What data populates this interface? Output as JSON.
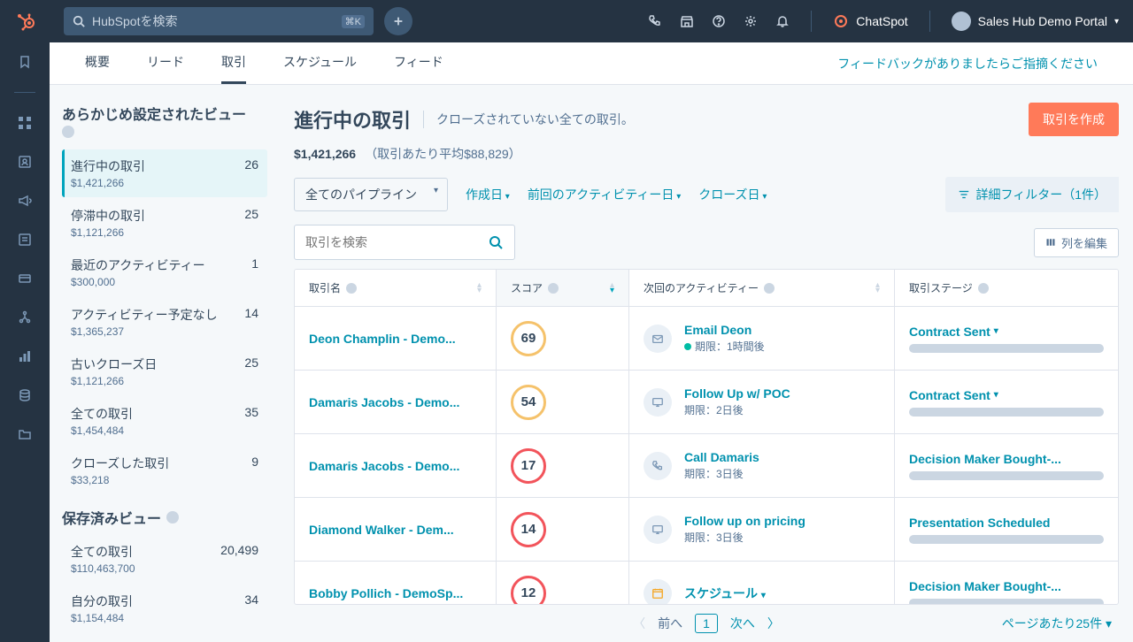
{
  "search_placeholder": "HubSpotを検索",
  "kbd": "⌘K",
  "chatspot": "ChatSpot",
  "portal": "Sales Hub Demo Portal",
  "tabs": [
    "概要",
    "リード",
    "取引",
    "スケジュール",
    "フィード"
  ],
  "active_tab": 2,
  "feedback": "フィードバックがありましたらご指摘ください",
  "preset_title": "あらかじめ設定されたビュー",
  "preset_views": [
    {
      "name": "進行中の取引",
      "amount": "$1,421,266",
      "count": "26",
      "active": true
    },
    {
      "name": "停滞中の取引",
      "amount": "$1,121,266",
      "count": "25"
    },
    {
      "name": "最近のアクティビティー",
      "amount": "$300,000",
      "count": "1"
    },
    {
      "name": "アクティビティー予定なし",
      "amount": "$1,365,237",
      "count": "14"
    },
    {
      "name": "古いクローズ日",
      "amount": "$1,121,266",
      "count": "25"
    },
    {
      "name": "全ての取引",
      "amount": "$1,454,484",
      "count": "35"
    },
    {
      "name": "クローズした取引",
      "amount": "$33,218",
      "count": "9"
    }
  ],
  "saved_title": "保存済みビュー",
  "saved_views": [
    {
      "name": "全ての取引",
      "amount": "$110,463,700",
      "count": "20,499"
    },
    {
      "name": "自分の取引",
      "amount": "$1,154,484",
      "count": "34"
    }
  ],
  "page_title": "進行中の取引",
  "page_subtitle": "クローズされていない全ての取引。",
  "create_deal": "取引を作成",
  "total": "$1,421,266",
  "avg": "（取引あたり平均$88,829）",
  "pipeline_select": "全てのパイプライン",
  "filters": [
    "作成日",
    "前回のアクティビティー日",
    "クローズ日"
  ],
  "adv_filter": "詳細フィルター（1件）",
  "deal_search_placeholder": "取引を検索",
  "edit_cols": "列を編集",
  "columns": {
    "name": "取引名",
    "score": "スコア",
    "next": "次回のアクティビティー",
    "stage": "取引ステージ"
  },
  "rows": [
    {
      "name": "Deon Champlin - Demo...",
      "score": 69,
      "ring": "gold",
      "icon": "mail",
      "action": "Email Deon",
      "due": "期限：1時間後",
      "green": true,
      "stage": "Contract Sent",
      "caret": true
    },
    {
      "name": "Damaris Jacobs - Demo...",
      "score": 54,
      "ring": "gold",
      "icon": "present",
      "action": "Follow Up w/ POC",
      "due": "期限：2日後",
      "stage": "Contract Sent",
      "caret": true
    },
    {
      "name": "Damaris Jacobs - Demo...",
      "score": 17,
      "ring": "red",
      "icon": "phone",
      "action": "Call Damaris",
      "due": "期限：3日後",
      "stage": "Decision Maker Bought-..."
    },
    {
      "name": "Diamond Walker - Dem...",
      "score": 14,
      "ring": "red",
      "icon": "present",
      "action": "Follow up on pricing",
      "due": "期限：3日後",
      "stage": "Presentation Scheduled"
    },
    {
      "name": "Bobby Pollich - DemoSp...",
      "score": 12,
      "ring": "red",
      "icon": "cal",
      "action": "スケジュール",
      "due": "",
      "caret_action": true,
      "stage": "Decision Maker Bought-..."
    }
  ],
  "prev": "前へ",
  "next": "次へ",
  "cur": "1",
  "perpage": "ページあたり25件"
}
